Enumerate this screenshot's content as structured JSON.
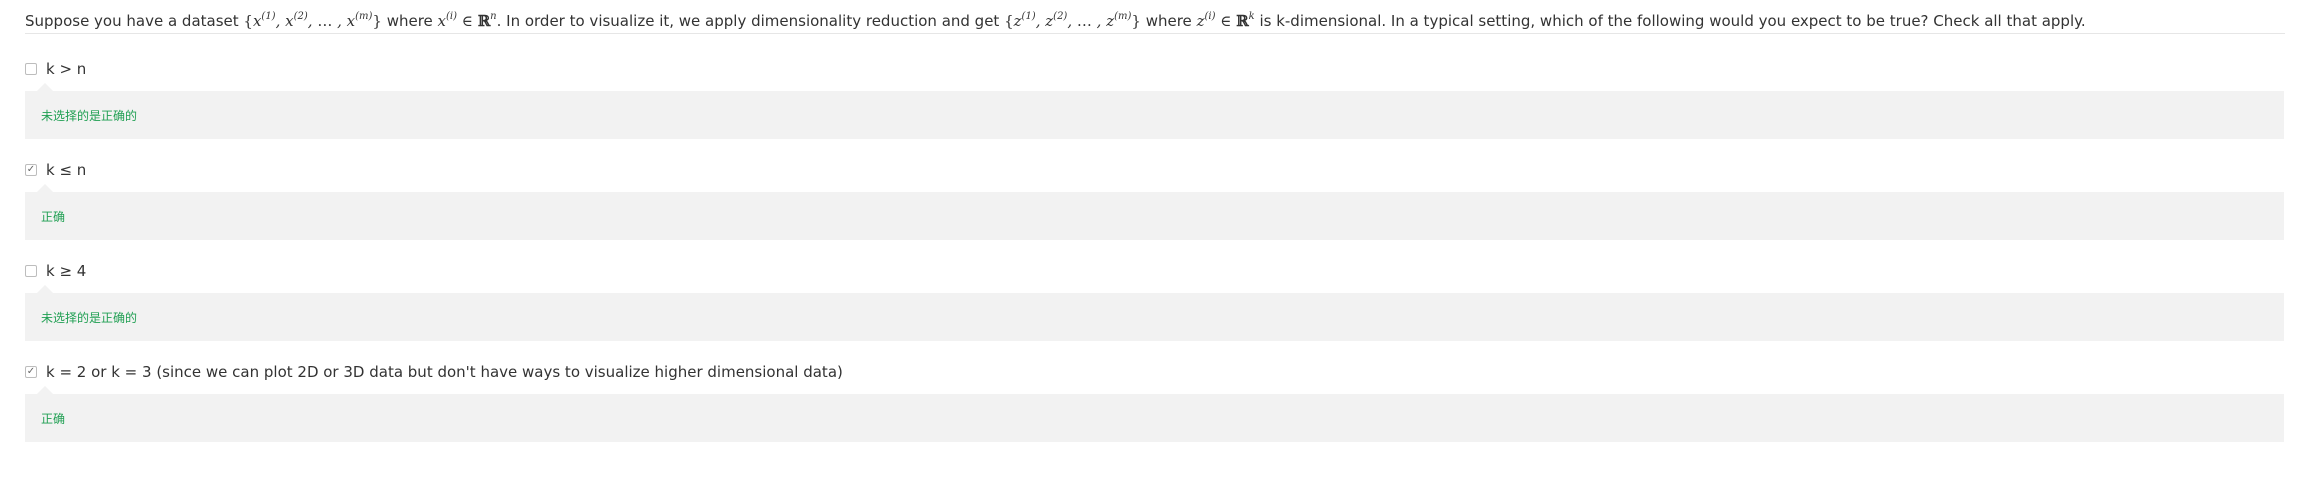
{
  "question": {
    "t1": "Suppose you have a dataset ",
    "t2": " where ",
    "t3": ". In order to visualize it, we apply dimensionality reduction and get ",
    "t4": " where ",
    "t5": " is k-dimensional. In a typical setting, which of the following would you expect to be true? Check all that apply."
  },
  "options": [
    {
      "label": "k > n",
      "checked": false,
      "feedback": "未选择的是正确的"
    },
    {
      "label": "k ≤ n",
      "checked": true,
      "feedback": "正确"
    },
    {
      "label": "k ≥ 4",
      "checked": false,
      "feedback": "未选择的是正确的"
    },
    {
      "label": "k = 2 or k = 3 (since we can plot 2D or 3D data but don't have ways to visualize higher dimensional data)",
      "checked": true,
      "feedback": "正确"
    }
  ],
  "colors": {
    "feedback_text": "#1f9f52",
    "feedback_background": "#f2f2f2",
    "text": "#333333"
  }
}
